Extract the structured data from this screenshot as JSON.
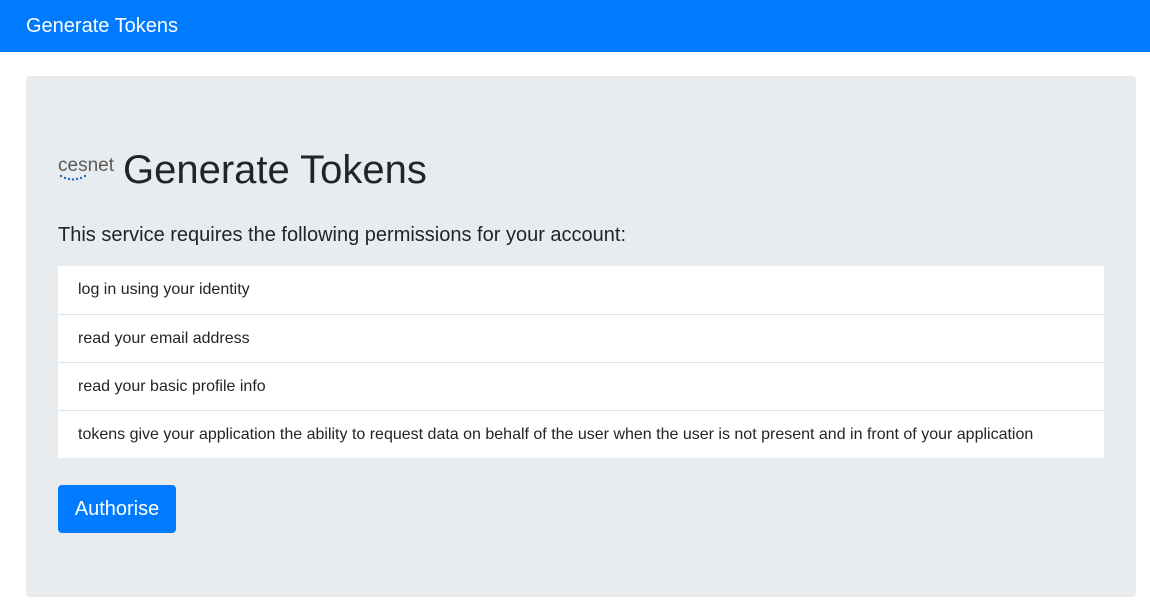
{
  "navbar": {
    "brand": "Generate Tokens"
  },
  "logo": {
    "text": "cesnet",
    "color": "#5a5a5a",
    "dots_color": "#1a73c8"
  },
  "main": {
    "title": "Generate Tokens",
    "lead": "This service requires the following permissions for your account:",
    "permissions": [
      "log in using your identity",
      "read your email address",
      "read your basic profile info",
      "tokens give your application the ability to request data on behalf of the user when the user is not present and in front of your application"
    ],
    "authorise_label": "Authorise"
  },
  "colors": {
    "primary": "#007bff",
    "jumbotron_bg": "#e9ecef"
  }
}
